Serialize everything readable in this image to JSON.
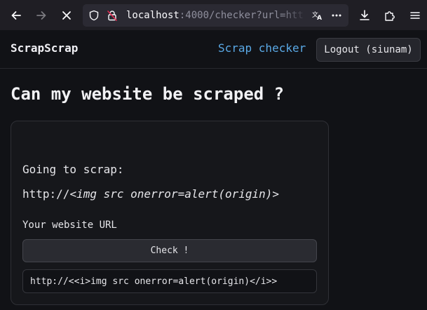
{
  "browser": {
    "url_host": "localhost",
    "url_rest": ":4000/checker?url=htt",
    "icons": {
      "back": "arrow-left-icon",
      "forward": "arrow-right-icon",
      "stop": "close-icon",
      "tracking": "shield-icon",
      "permissions": "lock-warning-icon",
      "translate": "translate-icon",
      "page_actions": "more-horizontal-icon",
      "downloads": "download-icon",
      "extensions": "puzzle-icon",
      "menu": "hamburger-menu-icon"
    }
  },
  "nav": {
    "brand": "ScrapScrap",
    "link": "Scrap checker",
    "logout": "Logout (siunam)"
  },
  "main": {
    "title": "Can my website be scraped ?",
    "going_label": "Going to scrap:",
    "target_prefix": "http://",
    "target_italic": "<img src onerror=alert(origin)>",
    "url_label": "Your website URL",
    "check_button": "Check !",
    "url_value": "http://<<i>img src onerror=alert(origin)</i>>"
  },
  "colors": {
    "accent_link": "#5aa9e6",
    "background": "#111216",
    "card": "#16171b"
  }
}
